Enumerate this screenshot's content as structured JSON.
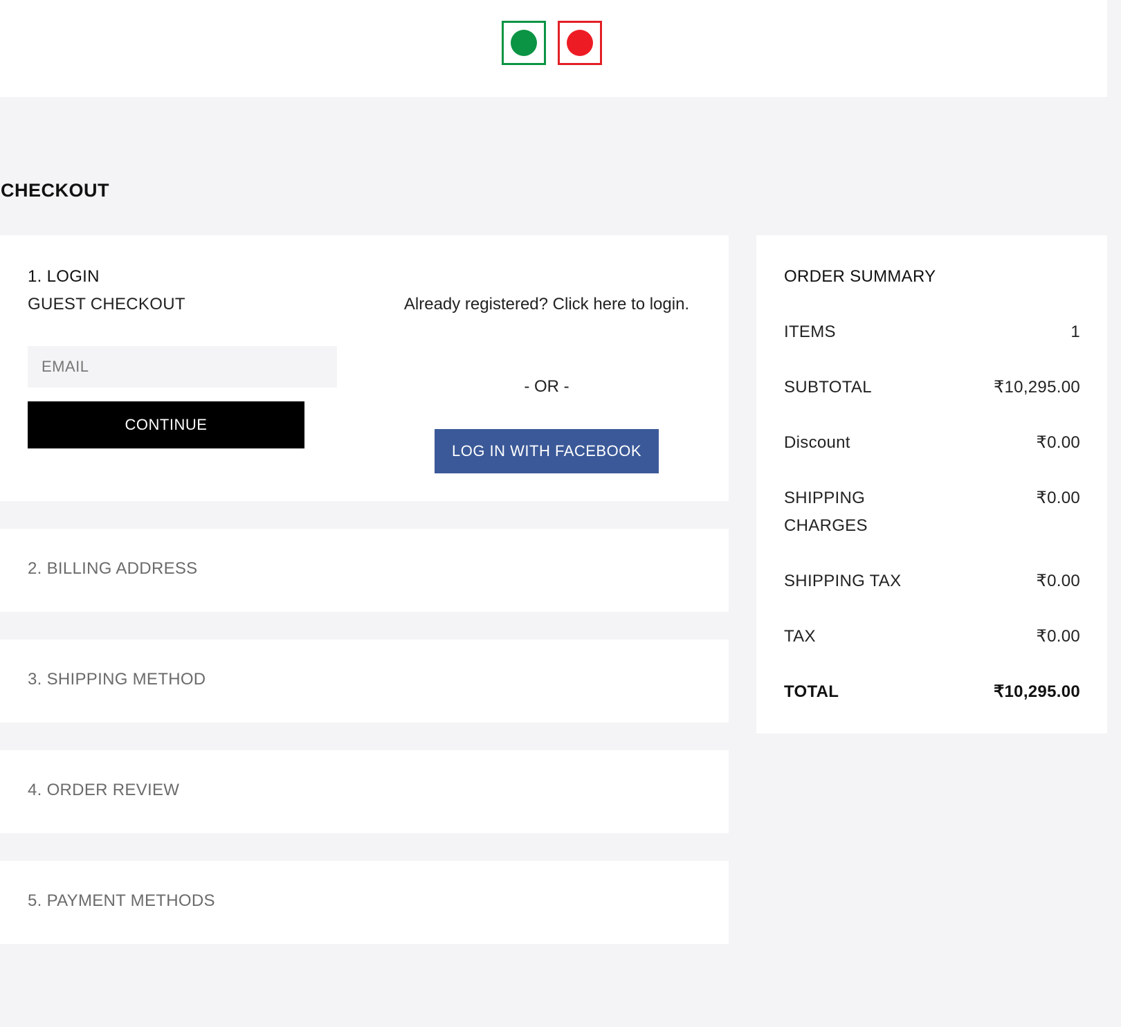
{
  "header": {
    "indicators": [
      {
        "name": "veg",
        "color": "#0b9444"
      },
      {
        "name": "non-veg",
        "color": "#ed1c24"
      }
    ]
  },
  "page_title": "CHECKOUT",
  "login": {
    "step_title": "1. LOGIN",
    "guest_label": "GUEST CHECKOUT",
    "email_placeholder": "EMAIL",
    "email_value": "",
    "continue_label": "CONTINUE",
    "already_registered": "Already registered? Click here to login.",
    "or_text": "- OR -",
    "facebook_label": "LOG IN WITH FACEBOOK",
    "facebook_color": "#3b5998"
  },
  "steps": [
    {
      "label": "2. BILLING ADDRESS"
    },
    {
      "label": "3. SHIPPING METHOD"
    },
    {
      "label": "4. ORDER REVIEW"
    },
    {
      "label": "5. PAYMENT METHODS"
    }
  ],
  "summary": {
    "title": "ORDER SUMMARY",
    "rows": [
      {
        "label": "ITEMS",
        "value": "1"
      },
      {
        "label": "SUBTOTAL",
        "value": "₹10,295.00"
      },
      {
        "label": "Discount",
        "value": "₹0.00"
      },
      {
        "label": "SHIPPING CHARGES",
        "value": "₹0.00"
      },
      {
        "label": "SHIPPING TAX",
        "value": "₹0.00"
      },
      {
        "label": "TAX",
        "value": "₹0.00"
      },
      {
        "label": "TOTAL",
        "value": "₹10,295.00"
      }
    ]
  }
}
